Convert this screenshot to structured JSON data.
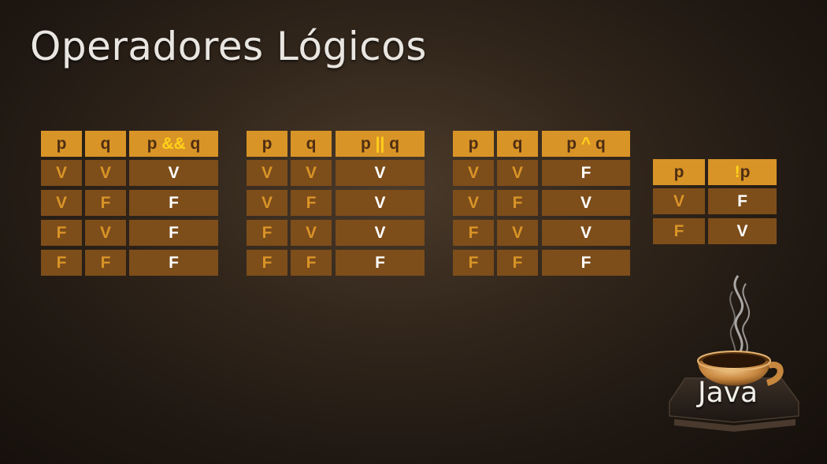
{
  "title": "Operadores Lógicos",
  "tables": [
    {
      "headers": {
        "p": "p",
        "q": "q",
        "op_left": "p ",
        "op_symbol": "&&",
        "op_right": " q"
      },
      "rows": [
        [
          "V",
          "V",
          "V"
        ],
        [
          "V",
          "F",
          "F"
        ],
        [
          "F",
          "V",
          "F"
        ],
        [
          "F",
          "F",
          "F"
        ]
      ]
    },
    {
      "headers": {
        "p": "p",
        "q": "q",
        "op_left": "p ",
        "op_symbol": "||",
        "op_right": " q"
      },
      "rows": [
        [
          "V",
          "V",
          "V"
        ],
        [
          "V",
          "F",
          "V"
        ],
        [
          "F",
          "V",
          "V"
        ],
        [
          "F",
          "F",
          "F"
        ]
      ]
    },
    {
      "headers": {
        "p": "p",
        "q": "q",
        "op_left": "p ",
        "op_symbol": "^",
        "op_right": " q"
      },
      "rows": [
        [
          "V",
          "V",
          "F"
        ],
        [
          "V",
          "F",
          "V"
        ],
        [
          "F",
          "V",
          "V"
        ],
        [
          "F",
          "F",
          "F"
        ]
      ]
    }
  ],
  "not_table": {
    "headers": {
      "p": "p",
      "op_symbol": "!",
      "op_right": "p"
    },
    "rows": [
      [
        "V",
        "F"
      ],
      [
        "F",
        "V"
      ]
    ]
  },
  "logo": {
    "text": "Java"
  },
  "colors": {
    "header": "#d99427",
    "body": "#7d4d1a",
    "symbol": "#ffd21a",
    "result": "#ffffff"
  }
}
